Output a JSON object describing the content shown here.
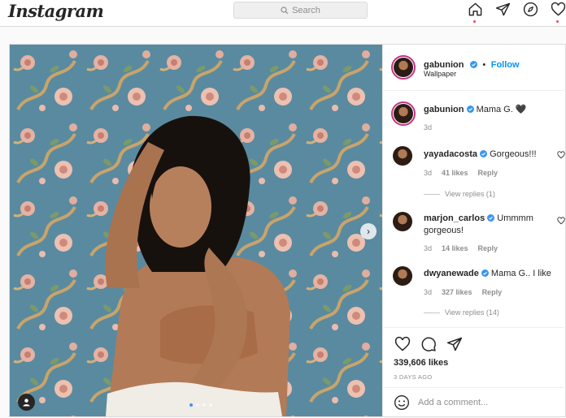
{
  "app": {
    "logo": "Instagram"
  },
  "search": {
    "placeholder": "Search"
  },
  "post": {
    "author": "gabunion",
    "follow_label": "Follow",
    "location": "Wallpaper",
    "caption": "Mama G. 🖤",
    "caption_time": "3d",
    "likes": "339,606 likes",
    "date": "3 DAYS AGO",
    "add_comment_placeholder": "Add a comment...",
    "carousel_count": 4,
    "carousel_index": 1
  },
  "comments": [
    {
      "user": "yayadacosta",
      "text": "Gorgeous!!!",
      "time": "3d",
      "likes": "41 likes",
      "reply": "Reply",
      "view_replies": "View replies (1)"
    },
    {
      "user": "marjon_carlos",
      "text": "Ummmm gorgeous!",
      "time": "3d",
      "likes": "14 likes",
      "reply": "Reply"
    },
    {
      "user": "dwyanewade",
      "text": "Mama G.. I like",
      "time": "3d",
      "likes": "327 likes",
      "reply": "Reply",
      "view_replies": "View replies (14)"
    }
  ],
  "colors": {
    "accent": "#0095f6",
    "verified": "#3897f0",
    "notification": "#ed4956"
  }
}
